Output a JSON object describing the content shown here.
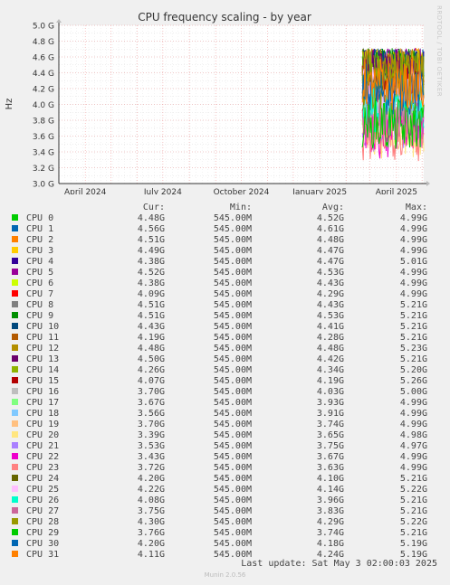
{
  "chart_data": {
    "type": "line",
    "title": "CPU frequency scaling - by year",
    "ylabel": "Hz",
    "ylim": [
      3000000000,
      5000000000
    ],
    "yticks": [
      "3.0 G",
      "3.2 G",
      "3.4 G",
      "3.6 G",
      "3.8 G",
      "4.0 G",
      "4.2 G",
      "4.4 G",
      "4.6 G",
      "4.8 G",
      "5.0 G"
    ],
    "xticks": [
      "April 2024",
      "July 2024",
      "October 2024",
      "January 2025",
      "April 2025"
    ],
    "xrange": [
      "2024-03-01",
      "2025-05-03"
    ],
    "tick_dates": [
      "2024-04-01",
      "2024-07-01",
      "2024-10-01",
      "2025-01-01",
      "2025-04-01"
    ],
    "data_start": "2025-02-20",
    "grid": true,
    "legend_placement": "bottom",
    "legend_headers": {
      "cur": "Cur:",
      "min": "Min:",
      "avg": "Avg:",
      "max": "Max:"
    },
    "series": [
      {
        "name": "CPU 0",
        "color": "#00cc00",
        "cur": "4.48G",
        "min": "545.00M",
        "avg": "4.52G",
        "max": "4.99G",
        "a": 4.52,
        "mx": 4.99
      },
      {
        "name": "CPU 1",
        "color": "#0066b3",
        "cur": "4.56G",
        "min": "545.00M",
        "avg": "4.61G",
        "max": "4.99G",
        "a": 4.61,
        "mx": 4.99
      },
      {
        "name": "CPU 2",
        "color": "#ff8000",
        "cur": "4.51G",
        "min": "545.00M",
        "avg": "4.48G",
        "max": "4.99G",
        "a": 4.48,
        "mx": 4.99
      },
      {
        "name": "CPU 3",
        "color": "#ffcc00",
        "cur": "4.49G",
        "min": "545.00M",
        "avg": "4.47G",
        "max": "4.99G",
        "a": 4.47,
        "mx": 4.99
      },
      {
        "name": "CPU 4",
        "color": "#330099",
        "cur": "4.38G",
        "min": "545.00M",
        "avg": "4.47G",
        "max": "5.01G",
        "a": 4.47,
        "mx": 5.01
      },
      {
        "name": "CPU 5",
        "color": "#990099",
        "cur": "4.52G",
        "min": "545.00M",
        "avg": "4.53G",
        "max": "4.99G",
        "a": 4.53,
        "mx": 4.99
      },
      {
        "name": "CPU 6",
        "color": "#ccff00",
        "cur": "4.38G",
        "min": "545.00M",
        "avg": "4.43G",
        "max": "4.99G",
        "a": 4.43,
        "mx": 4.99
      },
      {
        "name": "CPU 7",
        "color": "#ff0000",
        "cur": "4.09G",
        "min": "545.00M",
        "avg": "4.29G",
        "max": "4.99G",
        "a": 4.29,
        "mx": 4.99
      },
      {
        "name": "CPU 8",
        "color": "#808080",
        "cur": "4.51G",
        "min": "545.00M",
        "avg": "4.43G",
        "max": "5.21G",
        "a": 4.43,
        "mx": 5.21
      },
      {
        "name": "CPU 9",
        "color": "#008f00",
        "cur": "4.51G",
        "min": "545.00M",
        "avg": "4.53G",
        "max": "5.21G",
        "a": 4.53,
        "mx": 5.21
      },
      {
        "name": "CPU 10",
        "color": "#00487d",
        "cur": "4.43G",
        "min": "545.00M",
        "avg": "4.41G",
        "max": "5.21G",
        "a": 4.41,
        "mx": 5.21
      },
      {
        "name": "CPU 11",
        "color": "#b35a00",
        "cur": "4.19G",
        "min": "545.00M",
        "avg": "4.28G",
        "max": "5.21G",
        "a": 4.28,
        "mx": 5.21
      },
      {
        "name": "CPU 12",
        "color": "#b38f00",
        "cur": "4.48G",
        "min": "545.00M",
        "avg": "4.48G",
        "max": "5.23G",
        "a": 4.48,
        "mx": 5.23
      },
      {
        "name": "CPU 13",
        "color": "#6b006b",
        "cur": "4.50G",
        "min": "545.00M",
        "avg": "4.42G",
        "max": "5.21G",
        "a": 4.42,
        "mx": 5.21
      },
      {
        "name": "CPU 14",
        "color": "#8fb300",
        "cur": "4.26G",
        "min": "545.00M",
        "avg": "4.34G",
        "max": "5.20G",
        "a": 4.34,
        "mx": 5.2
      },
      {
        "name": "CPU 15",
        "color": "#b30000",
        "cur": "4.07G",
        "min": "545.00M",
        "avg": "4.19G",
        "max": "5.26G",
        "a": 4.19,
        "mx": 5.26
      },
      {
        "name": "CPU 16",
        "color": "#bebebe",
        "cur": "3.70G",
        "min": "545.00M",
        "avg": "4.03G",
        "max": "5.00G",
        "a": 4.03,
        "mx": 5.0
      },
      {
        "name": "CPU 17",
        "color": "#80ff80",
        "cur": "3.67G",
        "min": "545.00M",
        "avg": "3.93G",
        "max": "4.99G",
        "a": 3.93,
        "mx": 4.99
      },
      {
        "name": "CPU 18",
        "color": "#80c9ff",
        "cur": "3.56G",
        "min": "545.00M",
        "avg": "3.91G",
        "max": "4.99G",
        "a": 3.91,
        "mx": 4.99
      },
      {
        "name": "CPU 19",
        "color": "#ffc080",
        "cur": "3.70G",
        "min": "545.00M",
        "avg": "3.74G",
        "max": "4.99G",
        "a": 3.74,
        "mx": 4.99
      },
      {
        "name": "CPU 20",
        "color": "#ffe680",
        "cur": "3.39G",
        "min": "545.00M",
        "avg": "3.65G",
        "max": "4.98G",
        "a": 3.65,
        "mx": 4.98
      },
      {
        "name": "CPU 21",
        "color": "#aa80ff",
        "cur": "3.53G",
        "min": "545.00M",
        "avg": "3.75G",
        "max": "4.97G",
        "a": 3.75,
        "mx": 4.97
      },
      {
        "name": "CPU 22",
        "color": "#ee00cc",
        "cur": "3.43G",
        "min": "545.00M",
        "avg": "3.67G",
        "max": "4.99G",
        "a": 3.67,
        "mx": 4.99
      },
      {
        "name": "CPU 23",
        "color": "#ff8080",
        "cur": "3.72G",
        "min": "545.00M",
        "avg": "3.63G",
        "max": "4.99G",
        "a": 3.63,
        "mx": 4.99
      },
      {
        "name": "CPU 24",
        "color": "#666600",
        "cur": "4.20G",
        "min": "545.00M",
        "avg": "4.10G",
        "max": "5.21G",
        "a": 4.1,
        "mx": 5.21
      },
      {
        "name": "CPU 25",
        "color": "#ffbfff",
        "cur": "4.22G",
        "min": "545.00M",
        "avg": "4.14G",
        "max": "5.22G",
        "a": 4.14,
        "mx": 5.22
      },
      {
        "name": "CPU 26",
        "color": "#00ffcc",
        "cur": "4.08G",
        "min": "545.00M",
        "avg": "3.96G",
        "max": "5.21G",
        "a": 3.96,
        "mx": 5.21
      },
      {
        "name": "CPU 27",
        "color": "#cc6699",
        "cur": "3.75G",
        "min": "545.00M",
        "avg": "3.83G",
        "max": "5.21G",
        "a": 3.83,
        "mx": 5.21
      },
      {
        "name": "CPU 28",
        "color": "#999900",
        "cur": "4.30G",
        "min": "545.00M",
        "avg": "4.29G",
        "max": "5.22G",
        "a": 4.29,
        "mx": 5.22
      },
      {
        "name": "CPU 29",
        "color": "#00cc00",
        "cur": "3.76G",
        "min": "545.00M",
        "avg": "3.74G",
        "max": "5.21G",
        "a": 3.74,
        "mx": 5.21
      },
      {
        "name": "CPU 30",
        "color": "#0066b3",
        "cur": "4.20G",
        "min": "545.00M",
        "avg": "4.18G",
        "max": "5.19G",
        "a": 4.18,
        "mx": 5.19
      },
      {
        "name": "CPU 31",
        "color": "#ff8000",
        "cur": "4.11G",
        "min": "545.00M",
        "avg": "4.24G",
        "max": "5.19G",
        "a": 4.24,
        "mx": 5.19
      }
    ]
  },
  "last_update": "Last update: Sat May  3 02:00:03 2025",
  "footer": "Munin 2.0.56",
  "watermark": "RRDTOOL / TOBI OETIKER"
}
